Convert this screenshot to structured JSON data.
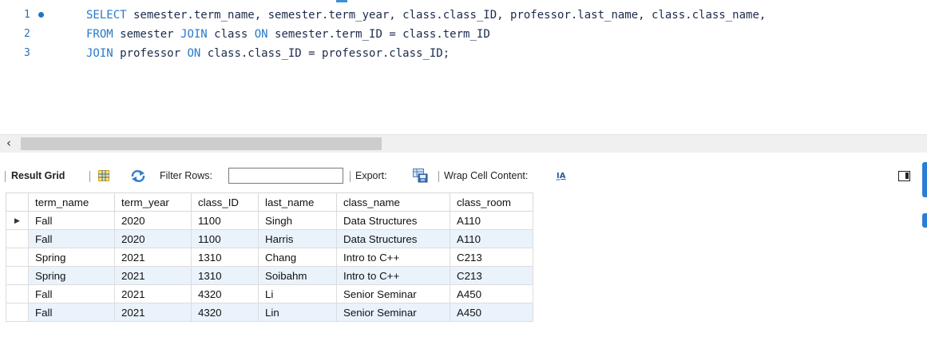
{
  "editor": {
    "lines": [
      {
        "number": "1",
        "has_marker": true,
        "parts": [
          {
            "t": "SELECT",
            "kw": true
          },
          {
            "t": " semester.term_name, semester.term_year, class.class_ID, professor.last_name, class.class_name, ",
            "kw": false
          }
        ]
      },
      {
        "number": "2",
        "has_marker": false,
        "parts": [
          {
            "t": "FROM",
            "kw": true
          },
          {
            "t": " semester ",
            "kw": false
          },
          {
            "t": "JOIN",
            "kw": true
          },
          {
            "t": " class ",
            "kw": false
          },
          {
            "t": "ON",
            "kw": true
          },
          {
            "t": " semester.term_ID = class.term_ID",
            "kw": false
          }
        ]
      },
      {
        "number": "3",
        "has_marker": false,
        "parts": [
          {
            "t": "JOIN",
            "kw": true
          },
          {
            "t": " professor ",
            "kw": false
          },
          {
            "t": "ON",
            "kw": true
          },
          {
            "t": " class.class_ID = professor.class_ID;",
            "kw": false
          }
        ]
      }
    ]
  },
  "toolbar": {
    "result_grid_label": "Result Grid",
    "filter_rows_label": "Filter Rows:",
    "filter_value": "",
    "export_label": "Export:",
    "wrap_label": "Wrap Cell Content:",
    "wrap_icon_glyph": "I̲A",
    "icons": [
      "grid-icon",
      "refresh-icon",
      "export-icon",
      "wrap-icon",
      "panel-toggle-icon"
    ]
  },
  "result": {
    "columns": [
      "term_name",
      "term_year",
      "class_ID",
      "last_name",
      "class_name",
      "class_room"
    ],
    "current_row_marker": "▶",
    "rows": [
      [
        "Fall",
        "2020",
        "1100",
        "Singh",
        "Data Structures",
        "A110"
      ],
      [
        "Fall",
        "2020",
        "1100",
        "Harris",
        "Data Structures",
        "A110"
      ],
      [
        "Spring",
        "2021",
        "1310",
        "Chang",
        "Intro to C++",
        "C213"
      ],
      [
        "Spring",
        "2021",
        "1310",
        "Soibahm",
        "Intro to C++",
        "C213"
      ],
      [
        "Fall",
        "2021",
        "4320",
        "Li",
        "Senior Seminar",
        "A450"
      ],
      [
        "Fall",
        "2021",
        "4320",
        "Lin",
        "Senior Seminar",
        "A450"
      ]
    ]
  },
  "scrollbar": {
    "left_arrow": "‹"
  },
  "colors": {
    "keyword": "#2779c9",
    "code_text": "#1c2b4a",
    "line_number": "#2a72b8",
    "accent": "#2a7fd4",
    "row_alt": "#eaf2fb"
  }
}
